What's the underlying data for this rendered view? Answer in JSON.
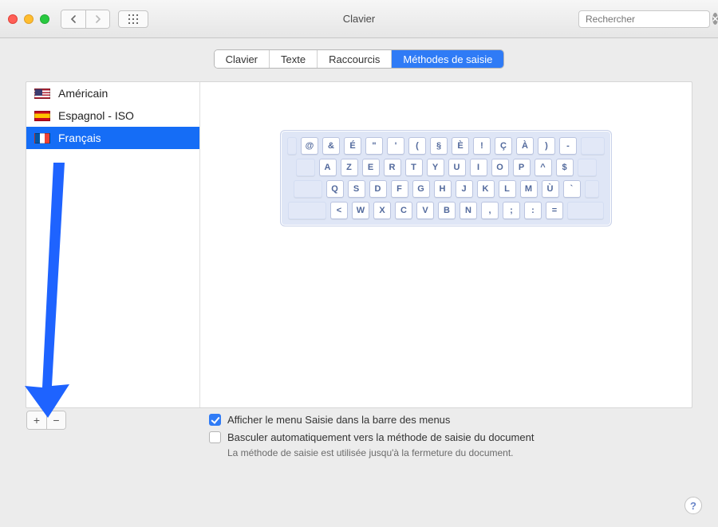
{
  "window": {
    "title": "Clavier"
  },
  "search": {
    "placeholder": "Rechercher"
  },
  "tabs": [
    {
      "label": "Clavier",
      "active": false
    },
    {
      "label": "Texte",
      "active": false
    },
    {
      "label": "Raccourcis",
      "active": false
    },
    {
      "label": "Méthodes de saisie",
      "active": true
    }
  ],
  "sources": [
    {
      "flag": "us",
      "label": "Américain",
      "selected": false
    },
    {
      "flag": "es",
      "label": "Espagnol - ISO",
      "selected": false
    },
    {
      "flag": "fr",
      "label": "Français",
      "selected": true
    }
  ],
  "keyboard_rows": [
    [
      "@",
      "&",
      "É",
      "\"",
      "'",
      "(",
      "§",
      "È",
      "!",
      "Ç",
      "À",
      ")",
      "-"
    ],
    [
      "A",
      "Z",
      "E",
      "R",
      "T",
      "Y",
      "U",
      "I",
      "O",
      "P",
      "^",
      "$"
    ],
    [
      "Q",
      "S",
      "D",
      "F",
      "G",
      "H",
      "J",
      "K",
      "L",
      "M",
      "Ù",
      "`"
    ],
    [
      "<",
      "W",
      "X",
      "C",
      "V",
      "B",
      "N",
      ",",
      ";",
      ":",
      "="
    ]
  ],
  "options": {
    "show_menu": {
      "checked": true,
      "label": "Afficher le menu Saisie dans la barre des menus"
    },
    "auto_switch": {
      "checked": false,
      "label": "Basculer automatiquement vers la méthode de saisie du document"
    },
    "hint": "La méthode de saisie est utilisée jusqu'à la fermeture du document."
  },
  "add_remove": {
    "add": "+",
    "remove": "−"
  },
  "help": "?"
}
